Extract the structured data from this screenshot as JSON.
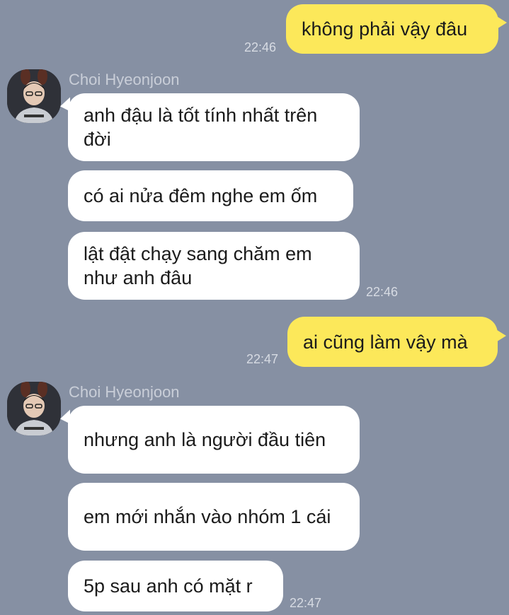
{
  "contact": {
    "name": "Choi Hyeonjoon"
  },
  "messages": [
    {
      "from": "me",
      "text": "không phải vậy đâu",
      "time": "22:46"
    },
    {
      "from": "contact",
      "text": "anh đậu là tốt tính nhất trên đời"
    },
    {
      "from": "contact",
      "text": "có ai nửa đêm nghe em ốm"
    },
    {
      "from": "contact",
      "text": "lật đật chạy sang chăm em như anh đâu",
      "time": "22:46"
    },
    {
      "from": "me",
      "text": "ai cũng làm vậy mà",
      "time": "22:47"
    },
    {
      "from": "contact",
      "text": "nhưng anh là người đầu tiên"
    },
    {
      "from": "contact",
      "text": "em mới nhắn vào nhóm 1 cái"
    },
    {
      "from": "contact",
      "text": "5p sau anh có mặt r",
      "time": "22:47"
    }
  ],
  "colors": {
    "background": "#8690a3",
    "outgoing_bubble": "#fce85a",
    "incoming_bubble": "#ffffff",
    "timestamp": "#d7dbe3",
    "sender_name": "#c9ced8"
  },
  "icons": {
    "avatar": "user-avatar-photo"
  }
}
